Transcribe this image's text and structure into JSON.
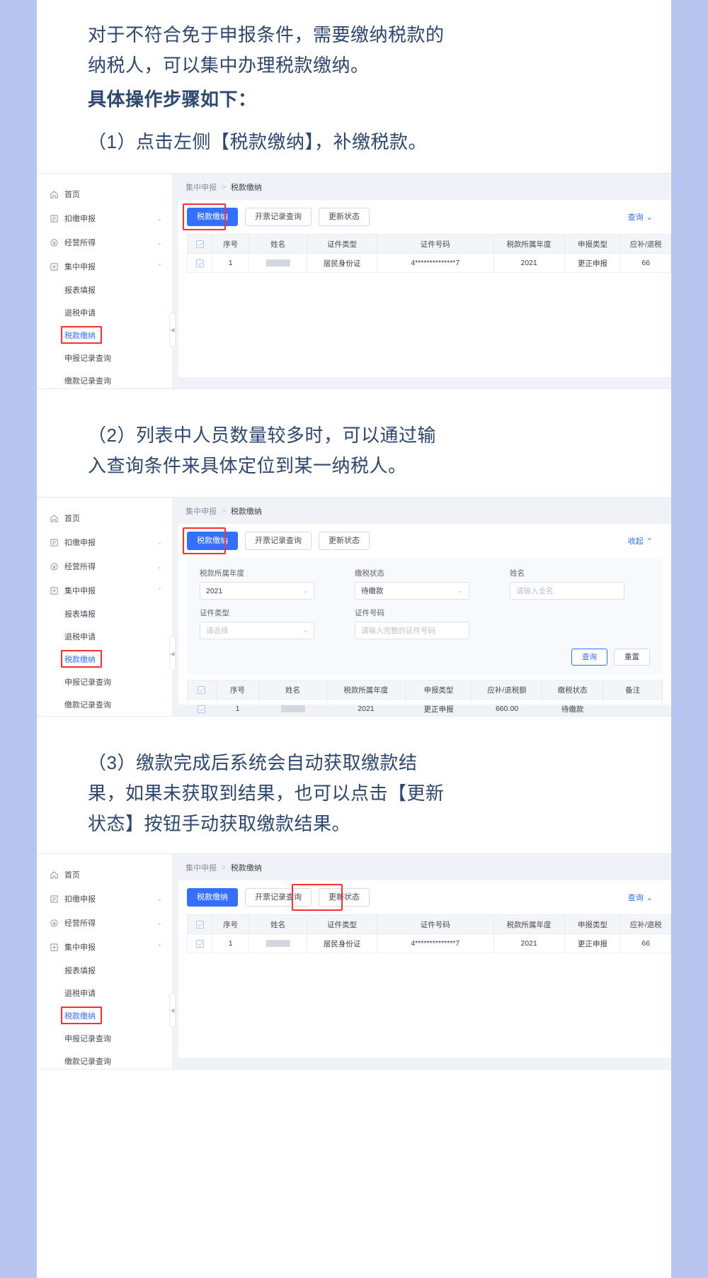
{
  "document": {
    "paragraphs": [
      {
        "id": "intro",
        "bold": false,
        "lines": [
          "对于不符合免于申报条件，需要缴纳税款的",
          "纳税人，可以集中办理税款缴纳。"
        ]
      },
      {
        "id": "steps-heading",
        "bold": true,
        "lines": [
          "具体操作步骤如下："
        ]
      },
      {
        "id": "step1",
        "bold": false,
        "lines": [
          "（1）点击左侧【税款缴纳】，补缴税款。"
        ]
      },
      {
        "id": "step2",
        "bold": false,
        "lines": [
          "（2）列表中人员数量较多时，可以通过输",
          "入查询条件来具体定位到某一纳税人。"
        ]
      },
      {
        "id": "step3",
        "bold": false,
        "lines": [
          "（3）缴款完成后系统会自动获取缴款结",
          "果，如果未获取到结果，也可以点击【更新",
          "状态】按钮手动获取缴款结果。"
        ]
      }
    ]
  },
  "colors": {
    "text": "#2c4770",
    "primary": "#3370ff",
    "highlight": "#ff2f2f",
    "page_bg": "#b8c6ef"
  },
  "sidebar": {
    "items": [
      {
        "label": "首页",
        "icon": "home-icon",
        "caret": ""
      },
      {
        "label": "扣缴申报",
        "icon": "form-icon",
        "caret": "⌄"
      },
      {
        "label": "经营所得",
        "icon": "money-icon",
        "caret": "⌄"
      },
      {
        "label": "集中申报",
        "icon": "batch-icon",
        "caret": "⌃"
      }
    ],
    "subitems": [
      {
        "label": "报表填报",
        "active": false,
        "boxed": false
      },
      {
        "label": "退税申请",
        "active": false,
        "boxed": false
      },
      {
        "label": "税款缴纳",
        "active": true,
        "boxed": true
      },
      {
        "label": "申报记录查询",
        "active": false,
        "boxed": false
      },
      {
        "label": "缴款记录查询",
        "active": false,
        "boxed": false
      }
    ],
    "collapse_icon": "◀"
  },
  "breadcrumb": {
    "parent": "集中申报",
    "separator": ">",
    "current": "税款缴纳"
  },
  "toolbar": {
    "buttons": [
      {
        "label": "税款缴纳",
        "primary": true
      },
      {
        "label": "开票记录查询",
        "primary": false
      },
      {
        "label": "更新状态",
        "primary": false
      }
    ],
    "query_expand": "查询",
    "query_collapse": "收起",
    "chevron_down": "⌄",
    "chevron_up": "⌃"
  },
  "search_form": {
    "fields": [
      {
        "label": "税款所属年度",
        "value": "2021",
        "placeholder": "",
        "type": "select"
      },
      {
        "label": "缴税状态",
        "value": "待缴款",
        "placeholder": "",
        "type": "select"
      },
      {
        "label": "姓名",
        "value": "",
        "placeholder": "请输入全名",
        "type": "input"
      },
      {
        "label": "证件类型",
        "value": "",
        "placeholder": "请选择",
        "type": "select"
      },
      {
        "label": "证件号码",
        "value": "",
        "placeholder": "请输入完整的证件号码",
        "type": "input"
      }
    ],
    "submit_label": "查询",
    "reset_label": "重置"
  },
  "table_full": {
    "headers": [
      "",
      "序号",
      "姓名",
      "证件类型",
      "证件号码",
      "税款所属年度",
      "申报类型",
      "应补/退税"
    ],
    "rows": [
      {
        "seq": "1",
        "name": "",
        "id_type": "居民身份证",
        "id_no": "4**************7",
        "tax_year": "2021",
        "decl_type": "更正申报",
        "amount": "66"
      }
    ]
  },
  "table_filtered": {
    "headers": [
      "",
      "序号",
      "姓名",
      "税款所属年度",
      "申报类型",
      "应补/退税额",
      "缴税状态",
      "备注"
    ],
    "rows": [
      {
        "seq": "1",
        "name": "",
        "tax_year": "2021",
        "decl_type": "更正申报",
        "amount": "660.00",
        "status": "待缴款",
        "remark": ""
      }
    ]
  }
}
